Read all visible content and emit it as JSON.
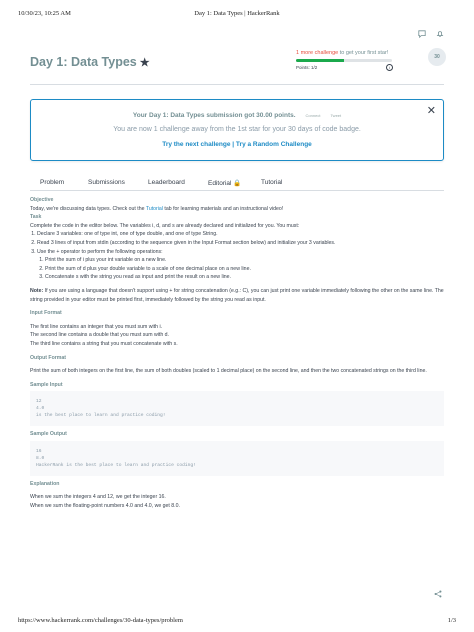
{
  "print": {
    "date": "10/30/23, 10:25 AM",
    "title": "Day 1: Data Types | HackerRank",
    "url": "https://www.hackerrank.com/challenges/30-data-types/problem",
    "page": "1/3"
  },
  "header": {
    "title": "Day 1: Data Types",
    "challenge_red": "1 more challenge",
    "challenge_grey": " to get your first star!",
    "progress": 0.5,
    "points": "Points: 1/2",
    "badge": "30"
  },
  "success": {
    "line1": "Your Day 1: Data Types submission got 30.00 points.",
    "action1": "Connect",
    "action2": "Tweet",
    "line2": "You are now 1 challenge away from the 1st star for your 30 days of code badge.",
    "link1": "Try the next challenge",
    "sep": " | ",
    "link2": "Try a Random Challenge"
  },
  "tabs": [
    "Problem",
    "Submissions",
    "Leaderboard",
    "Editorial",
    "Tutorial"
  ],
  "content": {
    "objective_h": "Objective",
    "objective_p1": "Today, we're discussing data types. Check out the ",
    "objective_link": "Tutorial",
    "objective_p2": " tab for learning materials and an instructional video!",
    "task_h": "Task",
    "task_p": "Complete the code in the editor below. The variables i, d, and s are already declared and initialized for you. You must:",
    "step1": "Declare 3 variables: one of type int, one of type double, and one of type String.",
    "step2": "Read 3 lines of input from stdin (according to the sequence given in the Input Format section below) and initialize your 3 variables.",
    "step3": "Use the + operator to perform the following operations:",
    "sub1": "Print the sum of i plus your int variable on a new line.",
    "sub2": "Print the sum of d plus your double variable to a scale of one decimal place on a new line.",
    "sub3": "Concatenate s with the string you read as input and print the result on a new line.",
    "note_b": "Note:",
    "note": " If you are using a language that doesn't support using + for string concatenation (e.g.: C), you can just print one variable immediately following the other on the same line. The string provided in your editor must be printed first, immediately followed by the string you read as input.",
    "input_h": "Input Format",
    "input1": "The first line contains an integer that you must sum with i.",
    "input2": "The second line contains a double that you must sum with d.",
    "input3": "The third line contains a string that you must concatenate with s.",
    "output_h": "Output Format",
    "output_p": "Print the sum of both integers on the first line, the sum of both doubles (scaled to 1 decimal place) on the second line, and then the two concatenated strings on the third line.",
    "sample_in_h": "Sample Input",
    "sample_in": [
      "12",
      "4.0",
      "is the best place to learn and practice coding!"
    ],
    "sample_out_h": "Sample Output",
    "sample_out": [
      "16",
      "8.0",
      "HackerRank is the best place to learn and practice coding!"
    ],
    "expl_h": "Explanation",
    "expl1": "When we sum the integers 4 and 12, we get the integer 16.",
    "expl2": "When we sum the floating-point numbers 4.0 and 4.0, we get 8.0."
  }
}
